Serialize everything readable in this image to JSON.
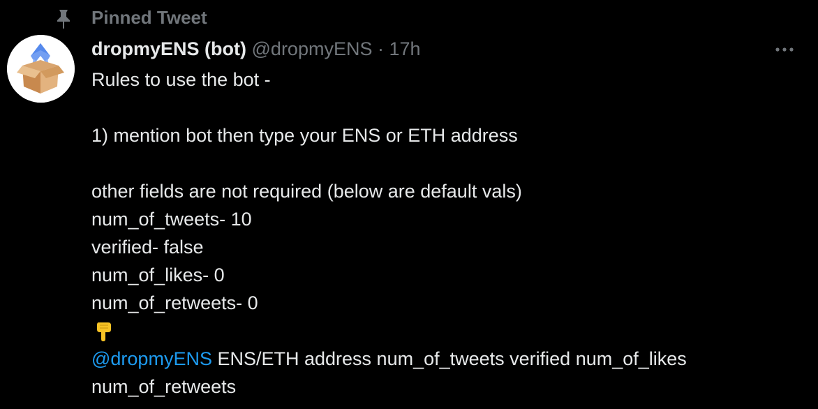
{
  "pinned": {
    "label": "Pinned Tweet",
    "icon": "pin-icon"
  },
  "tweet": {
    "display_name": "dropmyENS (bot)",
    "handle": "@dropmyENS",
    "separator": "·",
    "time": "17h",
    "more_icon": "more-horizontal-icon",
    "avatar_icon": "box-logo-icon",
    "lines": {
      "l1": "Rules to use the bot -",
      "l2": "1) mention bot then type your ENS or ETH address",
      "l3": "other fields are not required (below are default vals)",
      "l4": "num_of_tweets- 10",
      "l5": "verified- false",
      "l6": "num_of_likes- 0",
      "l7": "num_of_retweets- 0",
      "emoji": "👇",
      "mention": "@dropmyENS",
      "l8_rest": " ENS/ETH address num_of_tweets verified num_of_likes",
      "l9": "num_of_retweets"
    }
  },
  "colors": {
    "background": "#000000",
    "text": "#e7e9ea",
    "secondary": "#71767b",
    "link": "#1d9bf0"
  }
}
